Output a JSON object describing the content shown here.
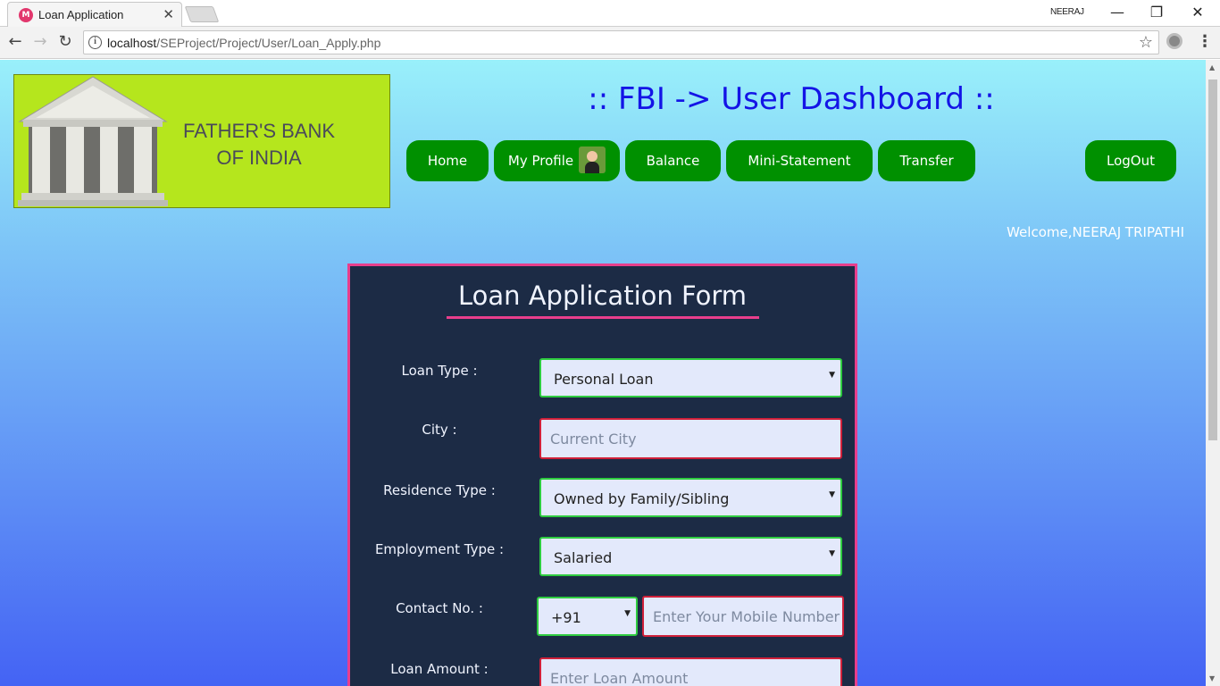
{
  "browser": {
    "tab_title": "Loan Application",
    "tab_close": "✕",
    "profile_name": "NEERAJ",
    "url_host": "localhost",
    "url_path": "/SEProject/Project/User/Loan_Apply.php"
  },
  "logo": {
    "line1": "FATHER'S BANK",
    "line2": "OF INDIA"
  },
  "header": {
    "title": ":: FBI -> User Dashboard ::",
    "welcome": "Welcome,NEERAJ TRIPATHI"
  },
  "nav": {
    "home": "Home",
    "profile": "My Profile",
    "balance": "Balance",
    "mini_statement": "Mini-Statement",
    "transfer": "Transfer",
    "logout": "LogOut"
  },
  "form": {
    "title": "Loan Application Form",
    "loan_type_label": "Loan Type :",
    "loan_type_value": "Personal Loan",
    "city_label": "City :",
    "city_placeholder": "Current City",
    "residence_label": "Residence Type :",
    "residence_value": "Owned by Family/Sibling",
    "employment_label": "Employment Type :",
    "employment_value": "Salaried",
    "contact_label": "Contact No. :",
    "country_code": "+91",
    "mobile_placeholder": "Enter Your Mobile Number",
    "amount_label": "Loan Amount :",
    "amount_placeholder": "Enter Loan Amount"
  },
  "colors": {
    "nav_button": "#009000",
    "form_bg": "#1c2b45",
    "form_border": "#e83e8c",
    "valid_border": "#2ecc40",
    "invalid_border": "#d0203a",
    "title_color": "#1414e6",
    "logo_bg": "#b5e61d"
  },
  "icons": {
    "back": "back-arrow-icon",
    "forward": "forward-arrow-icon",
    "reload": "reload-icon",
    "info": "info-icon",
    "bookmark": "star-icon",
    "extension": "extension-icon",
    "menu": "menu-icon",
    "select_arrow": "dropdown-arrow-icon",
    "avatar": "avatar-icon",
    "bank": "bank-building-icon"
  }
}
